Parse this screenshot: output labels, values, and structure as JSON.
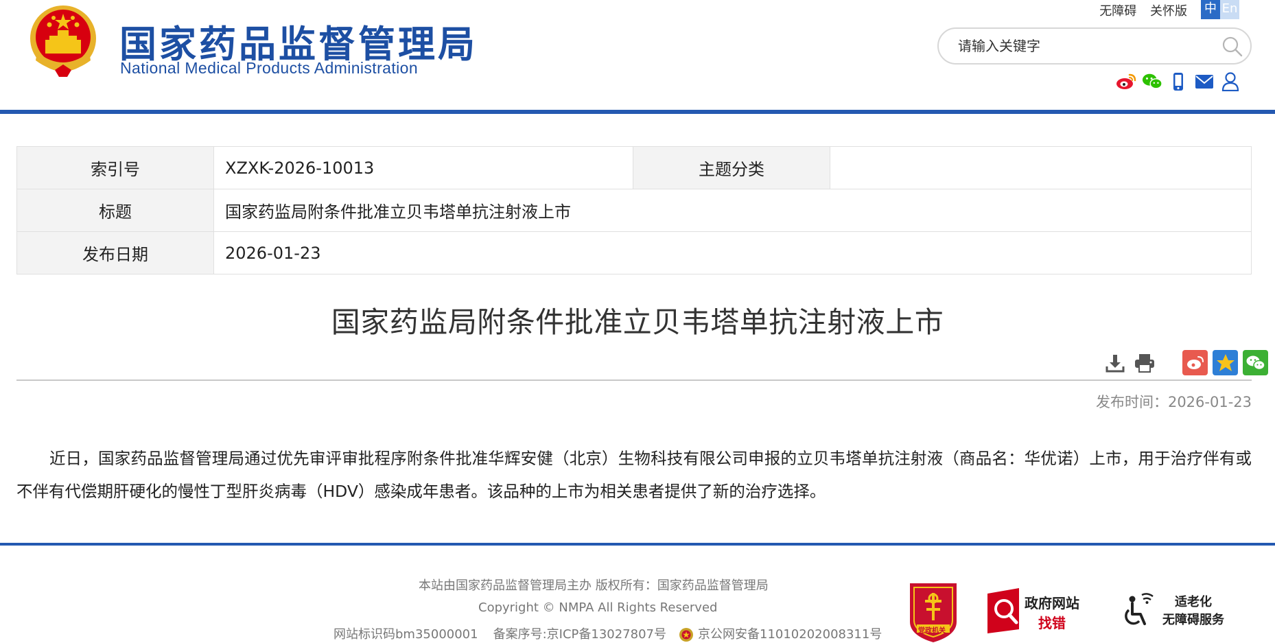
{
  "header": {
    "logo_cn": "国家药品监督管理局",
    "logo_en": "National Medical Products Administration",
    "accessibility_link": "无障碍",
    "care_link": "关怀版",
    "lang_cn": "中",
    "lang_en": "En",
    "search_placeholder": "请输入关键字"
  },
  "social_icons": [
    "weibo-icon",
    "wechat-icon",
    "mobile-icon",
    "mail-icon",
    "user-icon"
  ],
  "meta": {
    "index_label": "索引号",
    "index_value": "XZXK-2026-10013",
    "category_label": "主题分类",
    "category_value": "",
    "title_label": "标题",
    "title_value": "国家药监局附条件批准立贝韦塔单抗注射液上市",
    "date_label": "发布日期",
    "date_value": "2026-01-23"
  },
  "article": {
    "title": "国家药监局附条件批准立贝韦塔单抗注射液上市",
    "pub_time": "发布时间：2026-01-23",
    "body": "近日，国家药品监督管理局通过优先审评审批程序附条件批准华辉安健（北京）生物科技有限公司申报的立贝韦塔单抗注射液（商品名：华优诺）上市，用于治疗伴有或不伴有代偿期肝硬化的慢性丁型肝炎病毒（HDV）感染成年患者。该品种的上市为相关患者提供了新的治疗选择。"
  },
  "footer": {
    "sponsor": "本站由国家药品监督管理局主办 版权所有：国家药品监督管理局",
    "copyright": "Copyright © NMPA All Rights Reserved",
    "site_id": "网站标识码bm35000001",
    "icp": "备案序号:京ICP备13027807号",
    "police": "京公网安备11010202008311号",
    "party_badge": "党政机关",
    "gov_badge_line1": "政府网站",
    "gov_badge_line2": "找错",
    "access_badge_line1": "适老化",
    "access_badge_line2": "无障碍服务"
  },
  "colors": {
    "brand_blue": "#1d4fa3",
    "rule_blue": "#2459b1",
    "emblem_red": "#d7000f",
    "emblem_gold": "#f5c518"
  }
}
